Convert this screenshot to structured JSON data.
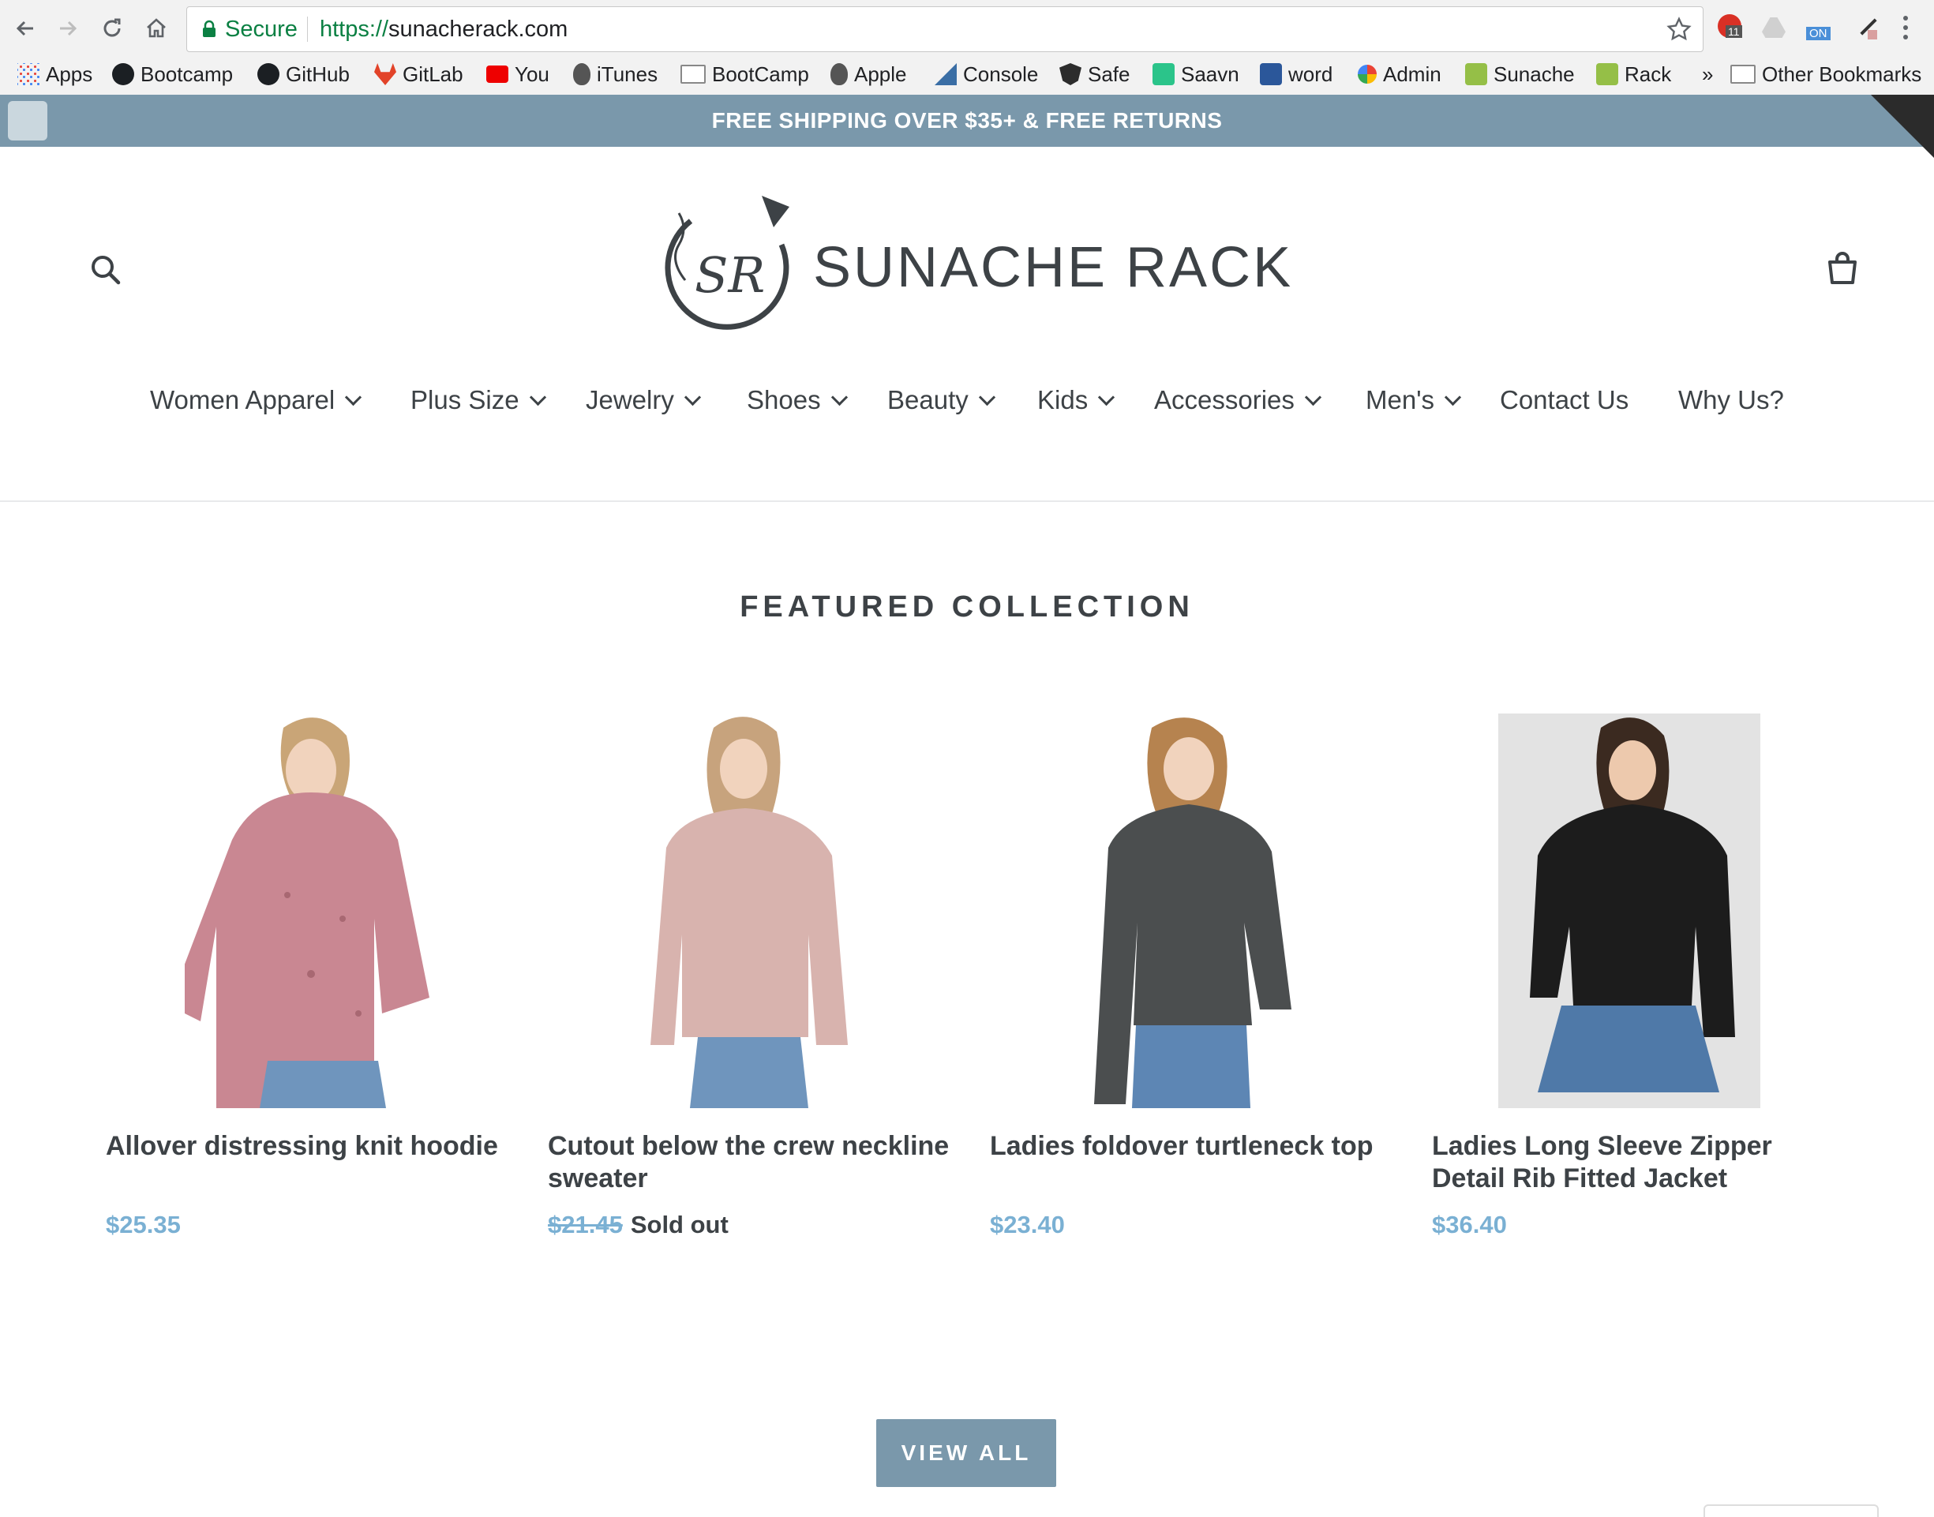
{
  "browser": {
    "secure_label": "Secure",
    "url_scheme": "https://",
    "url_host": "sunacherack.com",
    "extension_badge": "11",
    "extension_on": "ON",
    "more_label": "»",
    "bookmarks": [
      {
        "label": "Apps",
        "icon": "apps-grid-icon"
      },
      {
        "label": "Bootcamp",
        "icon": "github-icon"
      },
      {
        "label": "GitHub",
        "icon": "github-icon"
      },
      {
        "label": "GitLab",
        "icon": "gitlab-icon"
      },
      {
        "label": "You",
        "icon": "youtube-icon"
      },
      {
        "label": "iTunes",
        "icon": "apple-icon"
      },
      {
        "label": "BootCamp",
        "icon": "folder-icon"
      },
      {
        "label": "Apple",
        "icon": "apple-icon"
      },
      {
        "label": "Console",
        "icon": "console-icon"
      },
      {
        "label": "Safe",
        "icon": "shield-icon"
      },
      {
        "label": "Saavn",
        "icon": "saavn-icon"
      },
      {
        "label": "word",
        "icon": "word-icon"
      },
      {
        "label": "Admin",
        "icon": "google-icon"
      },
      {
        "label": "Sunache",
        "icon": "shopify-icon"
      },
      {
        "label": "Rack",
        "icon": "shopify-icon"
      }
    ],
    "other_bookmarks": "Other Bookmarks"
  },
  "banner": {
    "text": "FREE SHIPPING OVER $35+  & FREE RETURNS",
    "color": "#7a98ab"
  },
  "header": {
    "logo_monogram": "SR",
    "logo_text": "SUNACHE RACK"
  },
  "menu": [
    {
      "label": "Women Apparel",
      "dropdown": true
    },
    {
      "label": "Plus Size",
      "dropdown": true
    },
    {
      "label": "Jewelry",
      "dropdown": true
    },
    {
      "label": "Shoes",
      "dropdown": true
    },
    {
      "label": "Beauty",
      "dropdown": true
    },
    {
      "label": "Kids",
      "dropdown": true
    },
    {
      "label": "Accessories",
      "dropdown": true
    },
    {
      "label": "Men's",
      "dropdown": true
    },
    {
      "label": "Contact Us",
      "dropdown": false
    },
    {
      "label": "Why Us?",
      "dropdown": false
    }
  ],
  "featured": {
    "title": "FEATURED COLLECTION",
    "products": [
      {
        "title": "Allover distressing knit hoodie",
        "price": "$25.35",
        "old_price": "",
        "status": ""
      },
      {
        "title": "Cutout below the crew neckline sweater",
        "price": "",
        "old_price": "$21.45",
        "status": "Sold out"
      },
      {
        "title": "Ladies foldover turtleneck top",
        "price": "$23.40",
        "old_price": "",
        "status": ""
      },
      {
        "title": "Ladies Long Sleeve Zipper Detail Rib Fitted Jacket",
        "price": "$36.40",
        "old_price": "",
        "status": ""
      }
    ],
    "view_all": "VIEW ALL"
  },
  "colors": {
    "accent": "#7a98ab",
    "price": "#7ab0d3",
    "text": "#3d4246"
  }
}
